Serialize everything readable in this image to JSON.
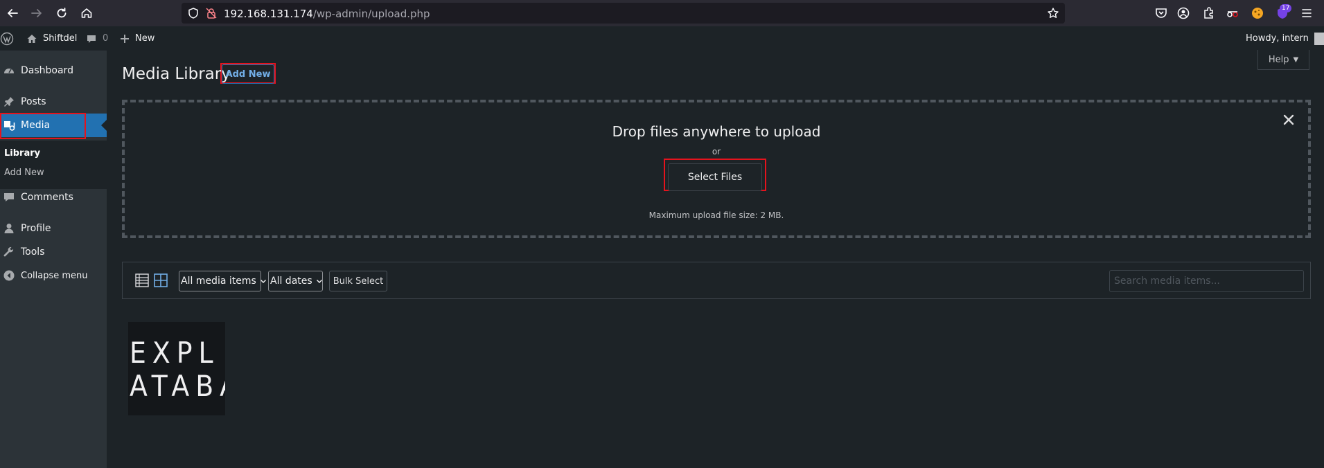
{
  "browser": {
    "url_host": "192.168.131.174",
    "url_path": "/wp-admin/upload.php",
    "badge_count": "17"
  },
  "adminbar": {
    "site_name": "Shiftdel",
    "comments_count": "0",
    "new_label": "New",
    "howdy": "Howdy, intern"
  },
  "sidebar": {
    "dashboard": "Dashboard",
    "posts": "Posts",
    "media": "Media",
    "library": "Library",
    "add_new": "Add New",
    "comments": "Comments",
    "profile": "Profile",
    "tools": "Tools",
    "collapse": "Collapse menu"
  },
  "main": {
    "title": "Media Library",
    "add_new": "Add New",
    "help": "Help",
    "drop_title": "Drop files anywhere to upload",
    "drop_or": "or",
    "select_files": "Select Files",
    "max_upload": "Maximum upload file size: 2 MB.",
    "filter_type": "All media items",
    "filter_date": "All dates",
    "bulk_select": "Bulk Select",
    "search_placeholder": "Search media items..."
  },
  "media_item": {
    "line1": "EXPL",
    "line2": "ATABA"
  },
  "colors": {
    "accent": "#2271b1",
    "highlight": "#e5131d",
    "bg": "#1d2327"
  }
}
